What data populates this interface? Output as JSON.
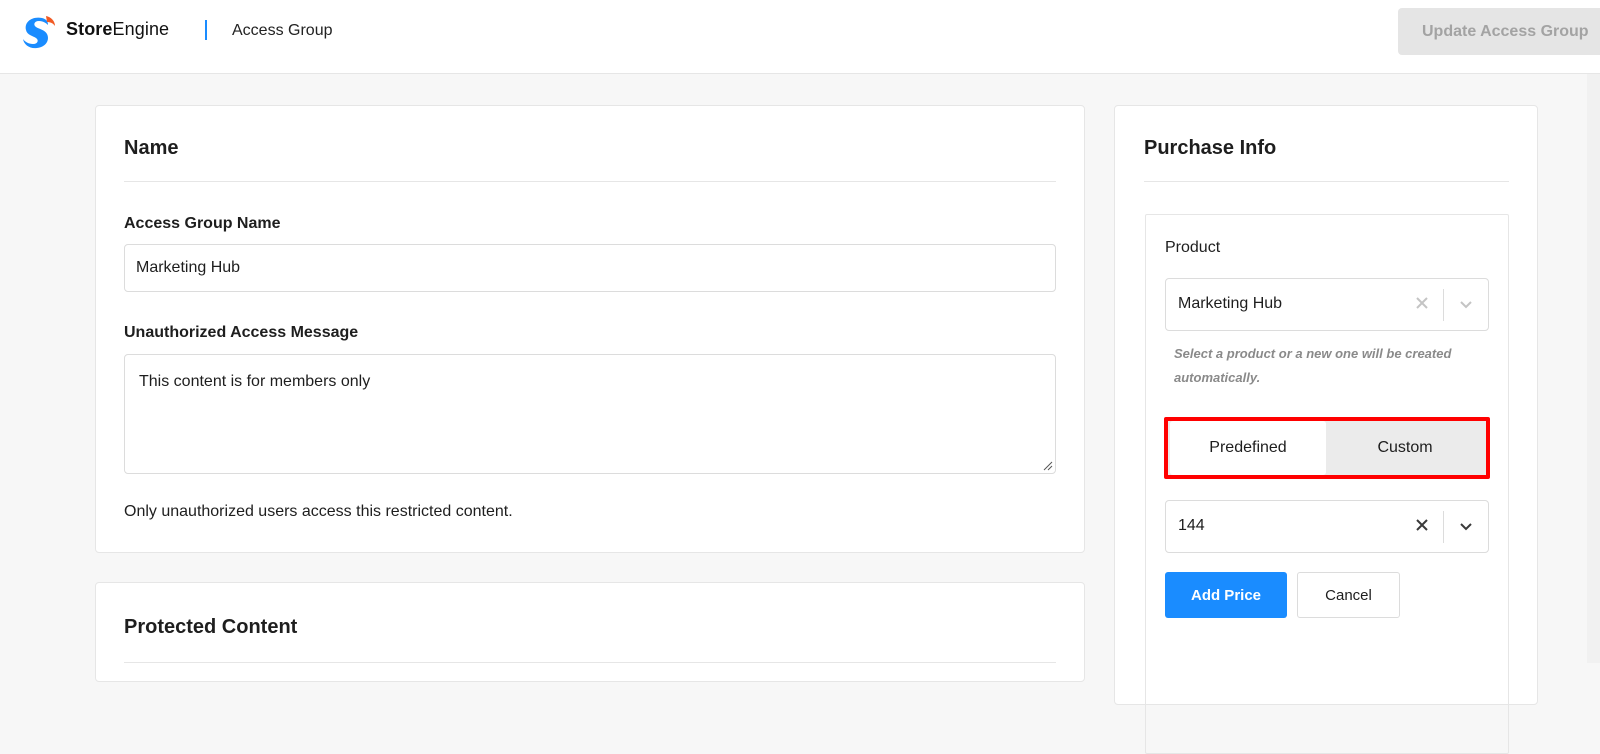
{
  "header": {
    "brand_bold": "Store",
    "brand_rest": "Engine",
    "crumb": "Access Group",
    "update_label": "Update Access Group"
  },
  "name_card": {
    "title": "Name",
    "group_name_label": "Access Group Name",
    "group_name_value": "Marketing Hub",
    "message_label": "Unauthorized Access Message",
    "message_value": "This content is for members only",
    "help": "Only unauthorized users access this restricted content."
  },
  "protected_card": {
    "title": "Protected Content"
  },
  "purchase": {
    "title": "Purchase Info",
    "product_label": "Product",
    "product_value": "Marketing Hub",
    "product_hint": "Select a product or a new one will be created automatically.",
    "price_modes": [
      "Predefined",
      "Custom"
    ],
    "selected_mode": "Predefined",
    "price_value": "144",
    "add_price_label": "Add Price",
    "cancel_label": "Cancel"
  },
  "colors": {
    "accent": "#1a8cff",
    "highlight": "#ff0000",
    "logo_blue": "#1a8cff",
    "logo_orange": "#f15a24"
  },
  "icons": [
    "logo-icon",
    "close-icon",
    "chevron-down-icon",
    "resize-grip-icon"
  ]
}
